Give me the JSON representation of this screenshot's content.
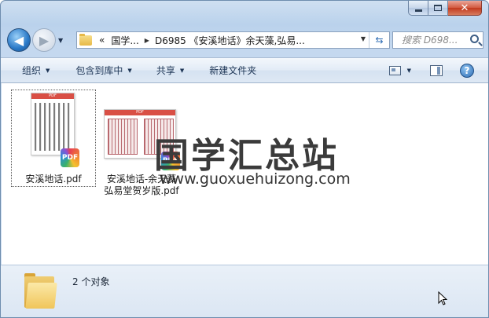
{
  "window": {
    "minimize_glyph": "",
    "maximize_glyph": "",
    "close_glyph": "✕"
  },
  "nav": {
    "back_glyph": "◀",
    "forward_glyph": "▶"
  },
  "address": {
    "overflow": "«",
    "crumbs": [
      "国学...",
      "D6985 《安溪地话》余天藻,弘易..."
    ]
  },
  "search": {
    "placeholder": "搜索 D698..."
  },
  "toolbar": {
    "organize": "组织",
    "include_in_library": "包含到库中",
    "share": "共享",
    "new_folder": "新建文件夹",
    "help": "?"
  },
  "files": [
    {
      "name": "安溪地话.pdf",
      "badge": "PDF",
      "thumb_header": "PDF"
    },
    {
      "name": "安溪地话-余天藻弘易堂贺岁版.pdf",
      "name_line1": "安溪地话-余天藻",
      "name_line2": "弘易堂贺岁版.pdf",
      "badge": "PDF",
      "thumb_header": "PDF"
    }
  ],
  "watermark": {
    "cn": "国学汇总站",
    "url": "www.guoxuehuizong.com"
  },
  "status": {
    "count": "2 个对象"
  }
}
